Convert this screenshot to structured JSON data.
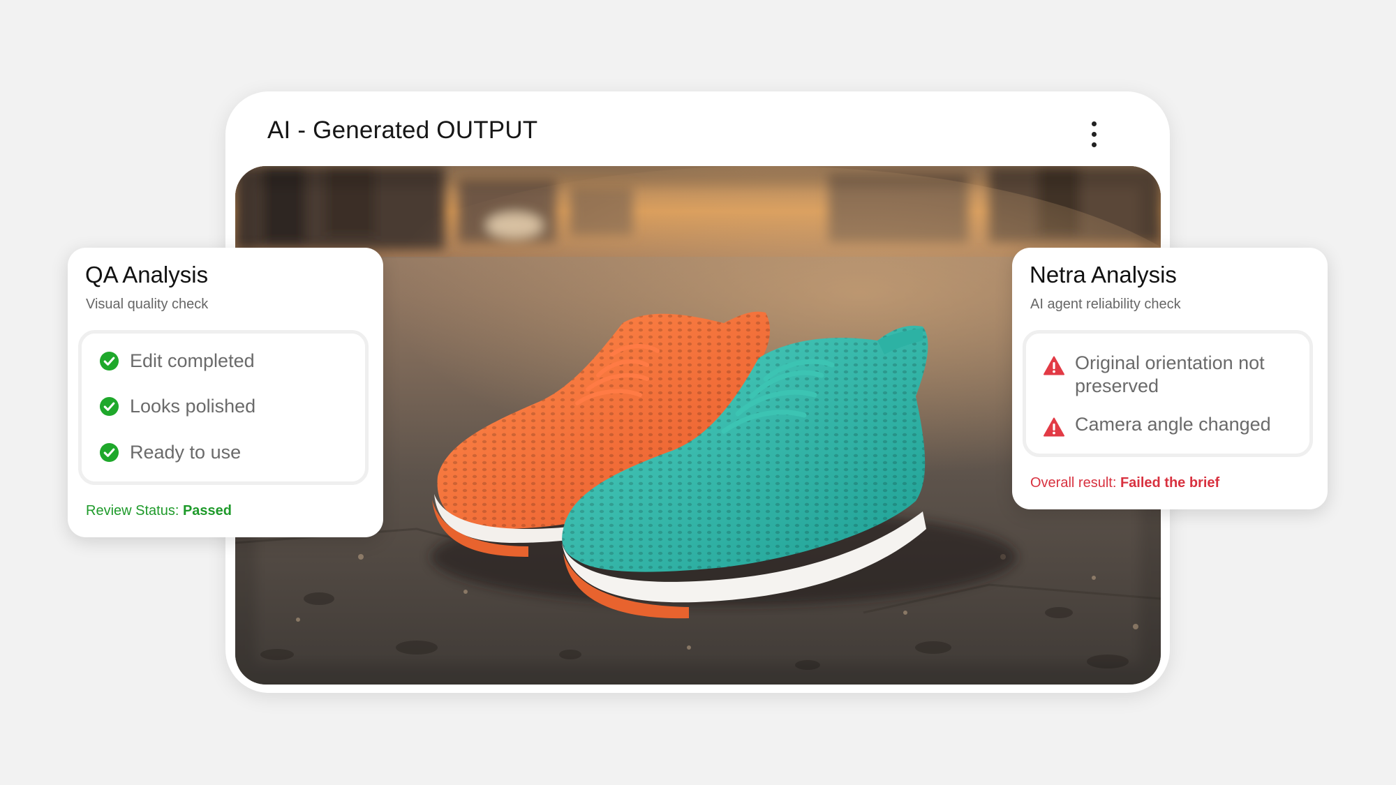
{
  "output_card": {
    "title": "AI - Generated OUTPUT",
    "menu_icon": "more-vertical-icon",
    "image_subject": "sneakers-on-street-photo"
  },
  "qa_card": {
    "title": "QA Analysis",
    "subtitle": "Visual quality check",
    "items": [
      {
        "icon": "check-circle-icon",
        "label": "Edit completed"
      },
      {
        "icon": "check-circle-icon",
        "label": "Looks polished"
      },
      {
        "icon": "check-circle-icon",
        "label": "Ready to use"
      }
    ],
    "status_label": "Review Status:",
    "status_value": "Passed"
  },
  "netra_card": {
    "title": "Netra Analysis",
    "subtitle": "AI agent reliability check",
    "items": [
      {
        "icon": "warning-triangle-icon",
        "label": "Original orientation not preserved"
      },
      {
        "icon": "warning-triangle-icon",
        "label": "Camera angle changed"
      }
    ],
    "result_label": "Overall result:",
    "result_value": "Failed the brief"
  },
  "colors": {
    "pass_green": "#1e9a2a",
    "check_green": "#1fa82b",
    "fail_red": "#d8313f",
    "background": "#f2f2f2"
  }
}
